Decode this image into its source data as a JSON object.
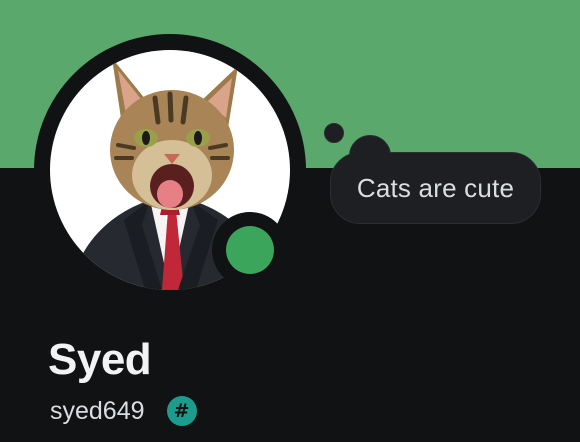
{
  "profile": {
    "display_name": "Syed",
    "username": "syed649",
    "custom_status": "Cats are cute",
    "status": "online",
    "badge": {
      "icon": "hashtag-icon",
      "symbol": "#"
    },
    "avatar": {
      "icon": "cat-in-suit-avatar"
    }
  },
  "colors": {
    "banner": "#5aa86c",
    "background": "#111214",
    "status_online": "#3ba55c",
    "badge": "#1c9c8c",
    "bubble": "#1e1f22"
  }
}
